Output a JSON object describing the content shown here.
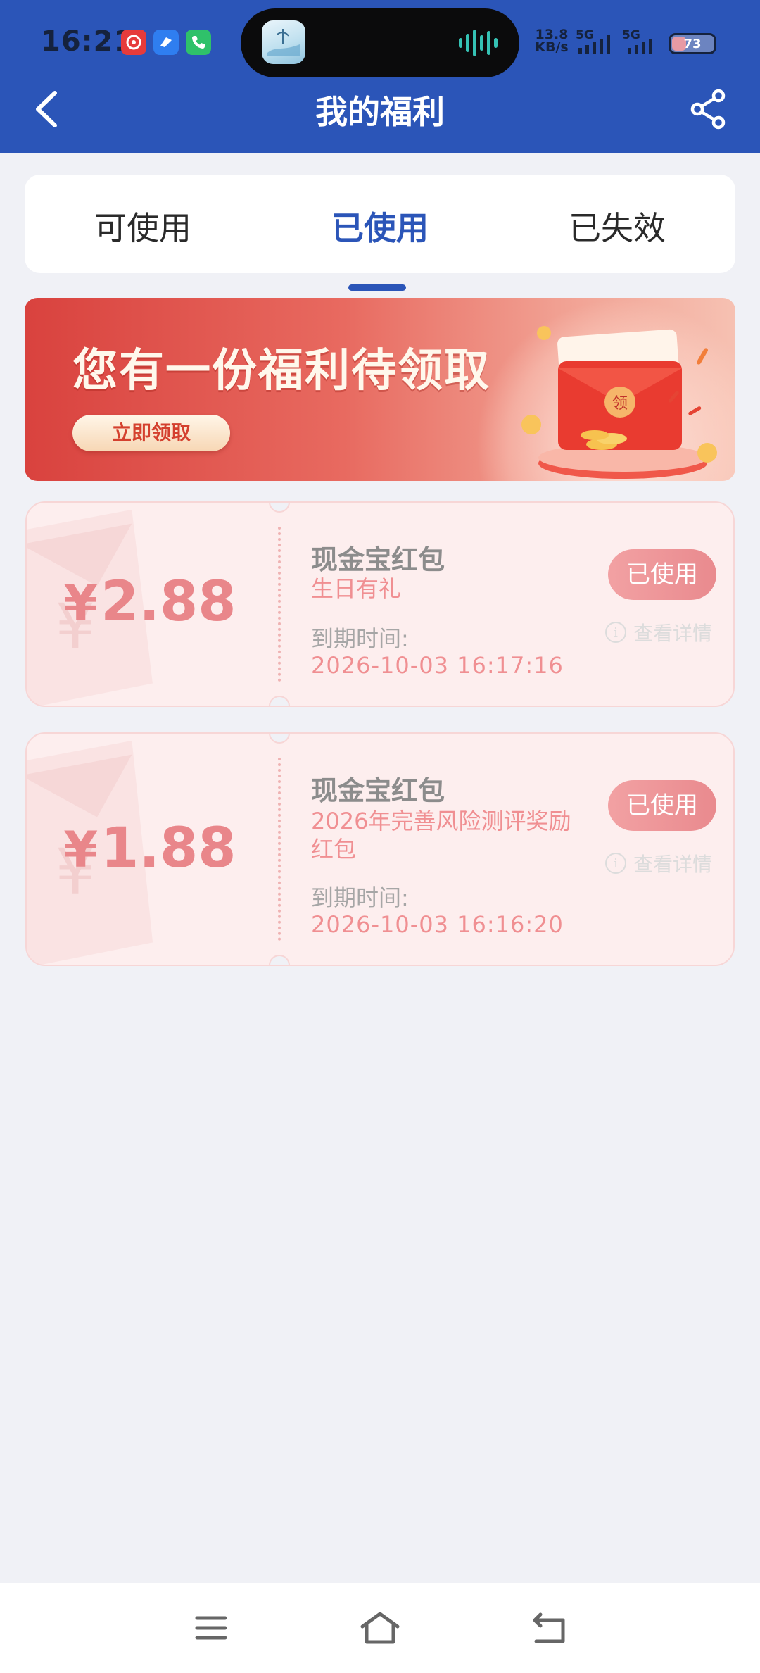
{
  "status_bar": {
    "time": "16:21",
    "net_speed_value": "13.8",
    "net_speed_unit": "KB/s",
    "signal_1": "5G",
    "signal_2": "5G",
    "battery": "73",
    "notification_icons": [
      "netease-music-icon",
      "blue-app-icon",
      "phone-app-icon"
    ]
  },
  "header": {
    "title": "我的福利",
    "background_color": "#2b55b8"
  },
  "tabs": [
    {
      "label": "可使用",
      "active": false
    },
    {
      "label": "已使用",
      "active": true
    },
    {
      "label": "已失效",
      "active": false
    }
  ],
  "banner": {
    "title": "您有一份福利待领取",
    "button_label": "立即领取",
    "envelope_char": "领"
  },
  "coupons": [
    {
      "currency": "¥",
      "amount": "2.88",
      "name": "现金宝红包",
      "subtitle": "生日有礼",
      "expire_label": "到期时间:",
      "expire_value": "2026-10-03 16:17:16",
      "status_label": "已使用",
      "details_label": "查看详情"
    },
    {
      "currency": "¥",
      "amount": "1.88",
      "name": "现金宝红包",
      "subtitle": "2026年完善风险测评奖励红包",
      "expire_label": "到期时间:",
      "expire_value": "2026-10-03 16:16:20",
      "status_label": "已使用",
      "details_label": "查看详情"
    }
  ],
  "bottom_nav": [
    "menu-icon",
    "home-icon",
    "back-icon"
  ]
}
